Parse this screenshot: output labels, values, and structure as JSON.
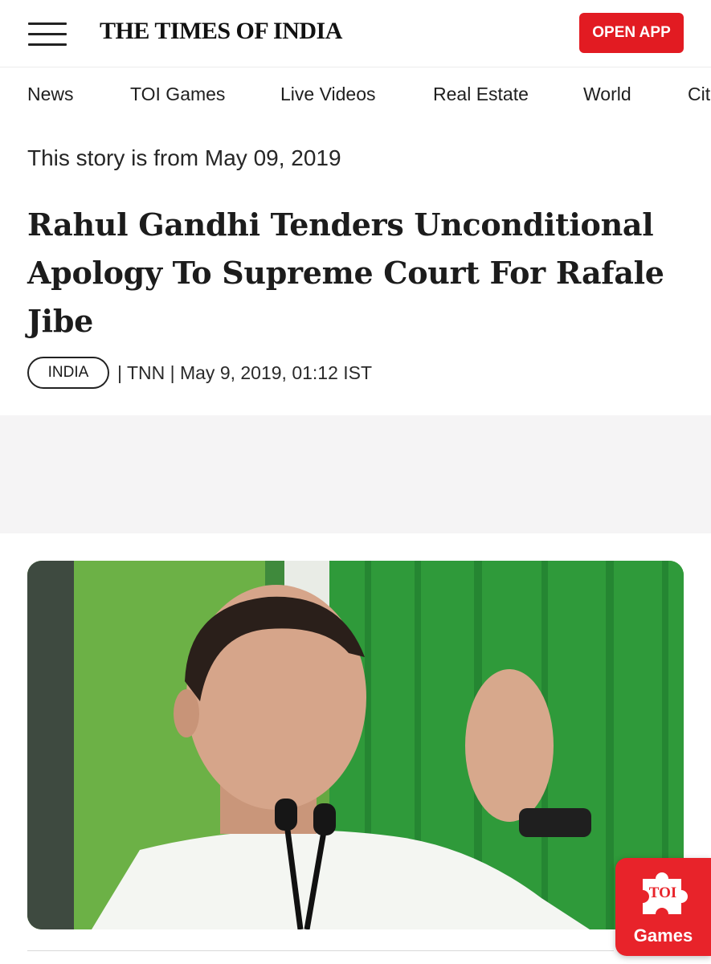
{
  "header": {
    "logo_text": "THE TIMES OF INDIA",
    "open_app_label": "OPEN APP",
    "accent_color": "#e21b22"
  },
  "nav": {
    "items": [
      {
        "label": "News"
      },
      {
        "label": "TOI Games"
      },
      {
        "label": "Live Videos"
      },
      {
        "label": "Real Estate"
      },
      {
        "label": "World"
      },
      {
        "label": "Cit"
      }
    ]
  },
  "article": {
    "story_date": "This story is from May 09, 2019",
    "headline": "Rahul Gandhi Tenders Unconditional Apology To Supreme Court For Rafale Jibe",
    "section_tag": "INDIA",
    "byline": "| TNN | May 9, 2019, 01:12 IST"
  },
  "games_widget": {
    "icon_text": "TOI",
    "label": "Games",
    "color": "#e8232a"
  },
  "icons": [
    "hamburger-menu-icon",
    "toi-games-puzzle-icon"
  ]
}
